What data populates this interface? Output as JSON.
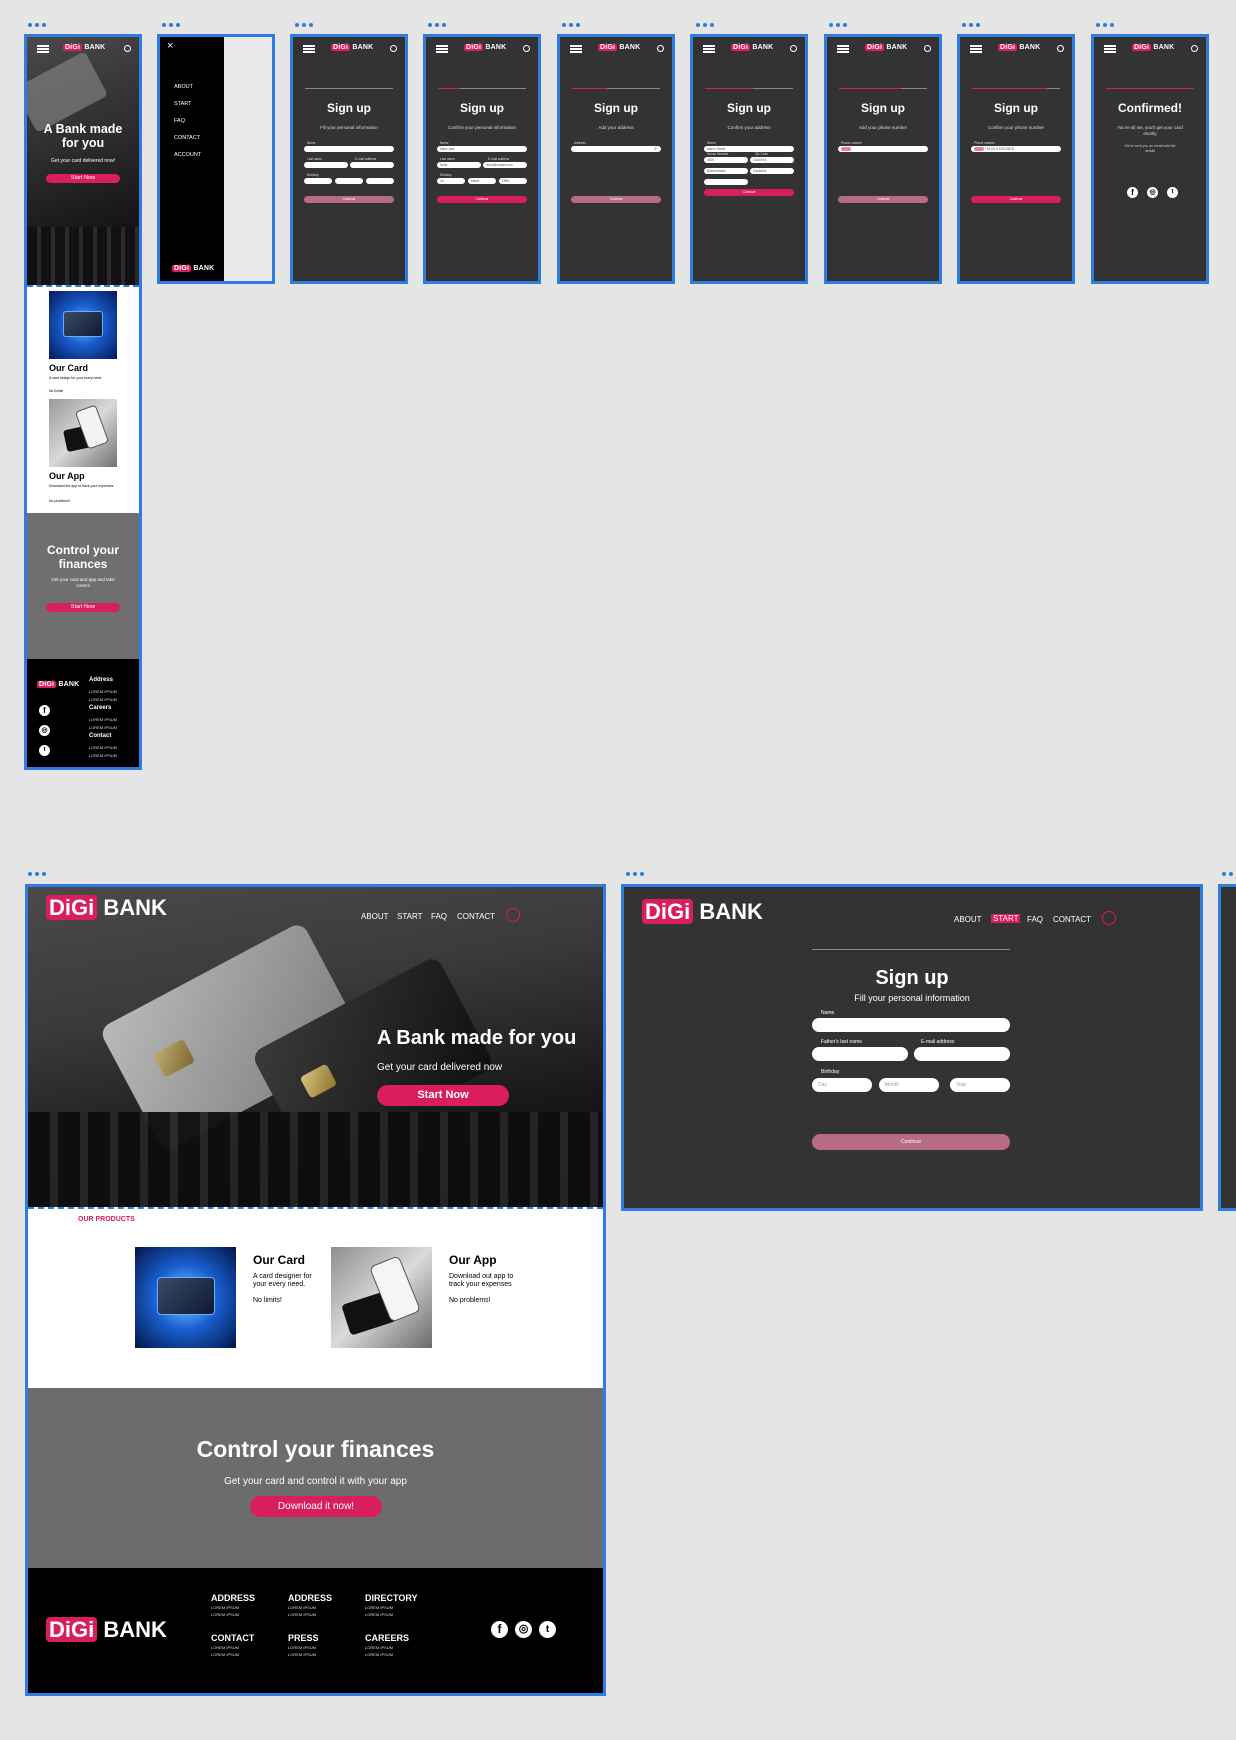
{
  "brand": {
    "digi": "DiGi",
    "bank": "BANK",
    "accent": "#d81e5b",
    "frame_color": "#2f7de1"
  },
  "mobile_home": {
    "hero_title": "A Bank made for you",
    "hero_sub": "Get your card delivered now!",
    "hero_button": "Start Now",
    "card_title": "Our Card",
    "card_desc": "A card design for your every need.",
    "card_note": "No limits!",
    "app_title": "Our App",
    "app_desc": "Download the app to track your expenses",
    "app_note": "No problems!",
    "control_title": "Control your finances",
    "control_desc": "Get your card and app and take control",
    "control_button": "Start Now",
    "footer": {
      "col1": "Address",
      "col2": "Careers",
      "col3": "Contact",
      "lorem": "LOREM IPSUM"
    }
  },
  "menu": {
    "items": [
      "ABOUT",
      "START",
      "FAQ",
      "CONTACT",
      "ACCOUNT"
    ],
    "close_icon": "close-icon"
  },
  "signup": {
    "title": "Sign up",
    "continue": "Continue",
    "step1_sub": "Fill your personal information",
    "step2_sub": "Confirm your personal information",
    "step3_sub": "Add your address",
    "step4_sub": "Confirm your address",
    "step5_sub": "Add your phone number",
    "step6_sub": "Confirm your phone number",
    "name_label": "Name",
    "last_name_label": "Last name",
    "email_label": "E-mail address",
    "birthday_label": "Birthday",
    "address_label": "Address",
    "street_label": "Street",
    "house_label": "House Number",
    "zip_label": "Zip Code",
    "phone_label": "Phone number",
    "name_val": "Mara Jaén",
    "last_val": "Nulia",
    "email_val": "Nick@hotmail.com",
    "day_val": "16",
    "month_val": "Maart",
    "year_val": "1990",
    "street_val": "Marco Street",
    "house_val": "4500",
    "zip_val": "1010XX4",
    "city_val": "Bloemendaal",
    "country_val": "Canberra",
    "phone_val": "+31 (0) 6 1234 5678"
  },
  "confirmed": {
    "title": "Confirmed!",
    "text": "You're all set, you'll get your card shortly",
    "sub": "We've sent you an email with the details"
  },
  "desktop_home": {
    "nav": [
      "ABOUT",
      "START",
      "FAQ",
      "CONTACT"
    ],
    "hero_title": "A Bank made for you",
    "hero_sub": "Get your card delivered now",
    "hero_button": "Start Now",
    "products_label": "OUR PRODUCTS",
    "card_title": "Our Card",
    "card_desc": "A card designer for your every need.",
    "card_note": "No limits!",
    "app_title": "Our App",
    "app_desc": "Download out app to track your expenses",
    "app_note": "No problems!",
    "control_title": "Control your finances",
    "control_sub": "Get your card and control it with your app",
    "control_button": "Download it now!",
    "footer_cols": [
      {
        "title": "ADDRESS",
        "a": "LOREM IPSUM",
        "b": "LOREM IPSUM"
      },
      {
        "title": "ADDRESS",
        "a": "LOREM IPSUM",
        "b": "LOREM IPSUM"
      },
      {
        "title": "DIRECTORY",
        "a": "LOREM IPSUM",
        "b": "LOREM IPSUM"
      },
      {
        "title": "CONTACT",
        "a": "LOREM IPSUM",
        "b": "LOREM IPSUM"
      },
      {
        "title": "PRESS",
        "a": "LOREM IPSUM",
        "b": "LOREM IPSUM"
      },
      {
        "title": "CAREERS",
        "a": "LOREM IPSUM",
        "b": "LOREM IPSUM"
      }
    ]
  },
  "desktop_signup": {
    "nav": [
      "ABOUT",
      "START",
      "FAQ",
      "CONTACT"
    ],
    "title": "Sign up",
    "sub": "Fill your personal information",
    "name_label": "Name",
    "father_label": "Father's last name",
    "email_label": "E-mail address",
    "birthday_label": "Birthday",
    "day_ph": "Day",
    "month_ph": "Month",
    "year_ph": "Year",
    "continue": "Continue"
  }
}
